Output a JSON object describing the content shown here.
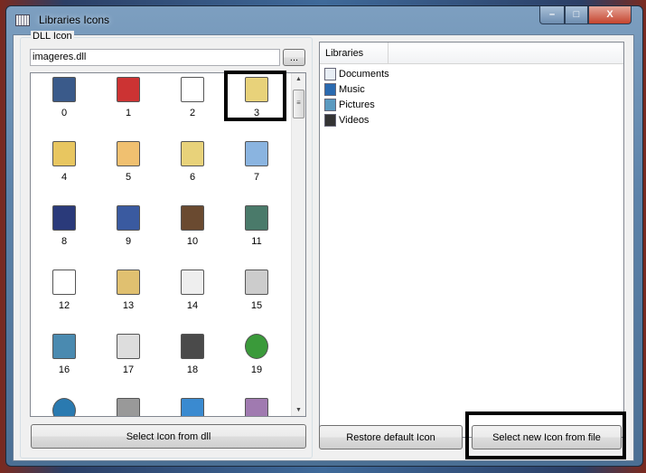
{
  "window": {
    "title": "Libraries Icons",
    "minimize": "–",
    "maximize": "□",
    "close": "X"
  },
  "left": {
    "group_label": "DLL Icon",
    "dll_path": "imageres.dll",
    "browse_label": "...",
    "icons": [
      {
        "index": "0",
        "icon": "monitor-windows-icon",
        "color": "#3a5a8a"
      },
      {
        "index": "1",
        "icon": "uac-shield-icon",
        "color": "#c33"
      },
      {
        "index": "2",
        "icon": "blank-document-icon",
        "color": "#fff"
      },
      {
        "index": "3",
        "icon": "folder-icon",
        "color": "#e8d27a"
      },
      {
        "index": "4",
        "icon": "folder-icon",
        "color": "#e8c660"
      },
      {
        "index": "5",
        "icon": "folder-icon",
        "color": "#f0c070"
      },
      {
        "index": "6",
        "icon": "folder-open-icon",
        "color": "#e8d27a"
      },
      {
        "index": "7",
        "icon": "search-document-icon",
        "color": "#8ab4e0"
      },
      {
        "index": "8",
        "icon": "dark-folder-icon",
        "color": "#2a3a7a"
      },
      {
        "index": "9",
        "icon": "dark-folder-icon",
        "color": "#3a5aa0"
      },
      {
        "index": "10",
        "icon": "games-icon",
        "color": "#6a4a30"
      },
      {
        "index": "11",
        "icon": "window-icon",
        "color": "#4a7a6a"
      },
      {
        "index": "12",
        "icon": "blank-square-icon",
        "color": "#fff"
      },
      {
        "index": "13",
        "icon": "folder-cd-icon",
        "color": "#e0c070"
      },
      {
        "index": "14",
        "icon": "text-document-icon",
        "color": "#eee"
      },
      {
        "index": "15",
        "icon": "mail-icon",
        "color": "#ccc"
      },
      {
        "index": "16",
        "icon": "picture-icon",
        "color": "#4a8ab0"
      },
      {
        "index": "17",
        "icon": "music-document-icon",
        "color": "#ddd"
      },
      {
        "index": "18",
        "icon": "film-icon",
        "color": "#4a4a4a"
      },
      {
        "index": "19",
        "icon": "media-center-icon",
        "color": "#3a9a3a"
      },
      {
        "index": "",
        "icon": "globe-network-icon",
        "color": "#2a7ab0"
      },
      {
        "index": "",
        "icon": "printer-folder-icon",
        "color": "#999"
      },
      {
        "index": "",
        "icon": "control-panel-icon",
        "color": "#3a8ad0"
      },
      {
        "index": "",
        "icon": "media-player-icon",
        "color": "#a07ab0"
      }
    ],
    "select_button": "Select Icon from dll"
  },
  "right": {
    "header": "Libraries",
    "items": [
      {
        "label": "Documents",
        "icon": "documents-icon",
        "color": "#e8eef5"
      },
      {
        "label": "Music",
        "icon": "music-icon",
        "color": "#2a6ab0"
      },
      {
        "label": "Pictures",
        "icon": "pictures-icon",
        "color": "#5a9ac0"
      },
      {
        "label": "Videos",
        "icon": "videos-icon",
        "color": "#333"
      }
    ],
    "restore_button": "Restore default Icon",
    "select_file_button": "Select new Icon from file"
  }
}
